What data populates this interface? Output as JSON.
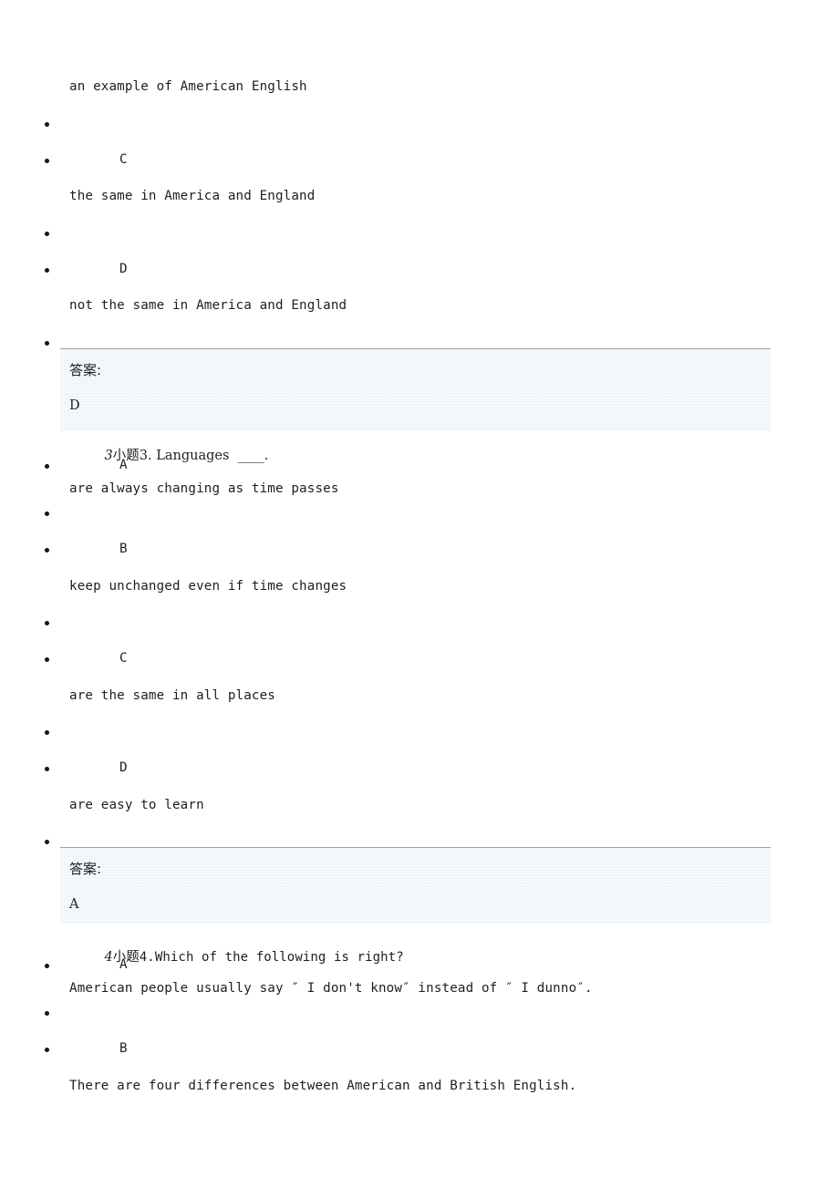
{
  "document": {
    "type": "exam-worksheet",
    "language": "en-CN",
    "answer_label": "答案:",
    "question_marker_suffix": "小题",
    "panel_bg_color": "#eef3f8",
    "panel_border_color": "#9aa3ad",
    "text_color": "#1e1e1e"
  },
  "content": {
    "carryover_option_text": "an example of American English",
    "q2_tail": {
      "options": [
        {
          "letter": "C",
          "text": "the same in America and England"
        },
        {
          "letter": "D",
          "text": "not the same in America and England"
        }
      ],
      "answer": "D"
    },
    "q3": {
      "number_italic": "3",
      "marker": "小题",
      "stem": "3. Languages  ____.",
      "options": [
        {
          "letter": "A",
          "text": "are always changing as time passes"
        },
        {
          "letter": "B",
          "text": "keep unchanged even if time changes"
        },
        {
          "letter": "C",
          "text": "are the same in all places"
        },
        {
          "letter": "D",
          "text": "are easy to learn"
        }
      ],
      "answer": "A"
    },
    "q4": {
      "number_italic": "4",
      "marker": "小题",
      "stem": "4.Which of the following is right?",
      "options": [
        {
          "letter": "A",
          "text": "American people usually say ″ I don't know″ instead of ″ I dunno″."
        },
        {
          "letter": "B",
          "text": "There are four differences between American and British English."
        }
      ]
    }
  }
}
